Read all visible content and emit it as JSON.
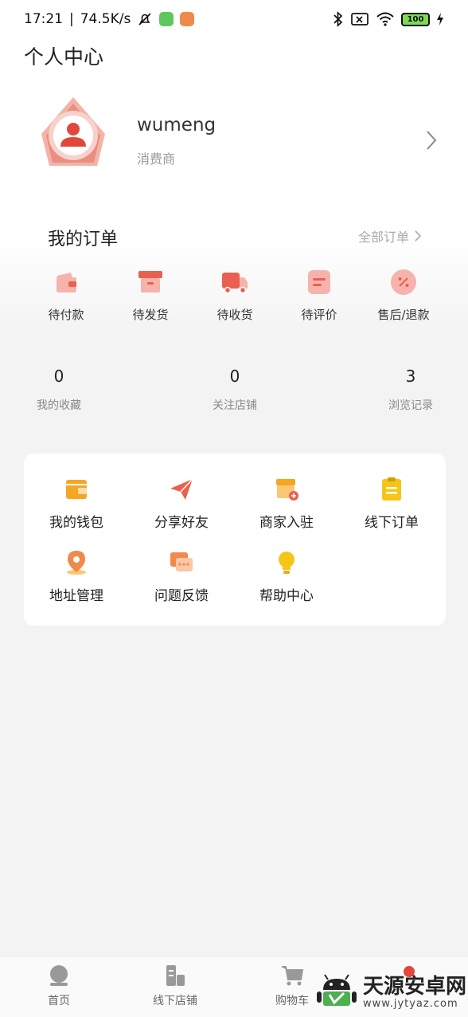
{
  "status_bar": {
    "time": "17:21",
    "speed": "74.5K/s",
    "battery": "100"
  },
  "page_title": "个人中心",
  "profile": {
    "username": "wumeng",
    "role": "消费商"
  },
  "orders": {
    "title": "我的订单",
    "all_label": "全部订单",
    "items": [
      {
        "label": "待付款",
        "icon": "wallet-icon"
      },
      {
        "label": "待发货",
        "icon": "box-icon"
      },
      {
        "label": "待收货",
        "icon": "truck-icon"
      },
      {
        "label": "待评价",
        "icon": "review-icon"
      },
      {
        "label": "售后/退款",
        "icon": "refund-icon"
      }
    ]
  },
  "stats": [
    {
      "value": "0",
      "label": "我的收藏"
    },
    {
      "value": "0",
      "label": "关注店铺"
    },
    {
      "value": "3",
      "label": "浏览记录"
    }
  ],
  "tools": [
    {
      "label": "我的钱包",
      "icon": "wallet-icon"
    },
    {
      "label": "分享好友",
      "icon": "paper-plane-icon"
    },
    {
      "label": "商家入驻",
      "icon": "store-icon"
    },
    {
      "label": "线下订单",
      "icon": "clipboard-icon"
    },
    {
      "label": "地址管理",
      "icon": "location-pin-icon"
    },
    {
      "label": "问题反馈",
      "icon": "chat-icon"
    },
    {
      "label": "帮助中心",
      "icon": "lightbulb-icon"
    }
  ],
  "tabbar": [
    {
      "label": "首页",
      "icon": "home-icon"
    },
    {
      "label": "线下店铺",
      "icon": "shop-icon"
    },
    {
      "label": "购物车",
      "icon": "cart-icon"
    },
    {
      "label": "",
      "icon": "profile-icon"
    }
  ],
  "watermark": {
    "title": "天源安卓网",
    "url": "www.jytyaz.com"
  },
  "colors": {
    "accent_red": "#e8604f",
    "accent_orange": "#f5a623",
    "background": "#f3f3f3"
  }
}
